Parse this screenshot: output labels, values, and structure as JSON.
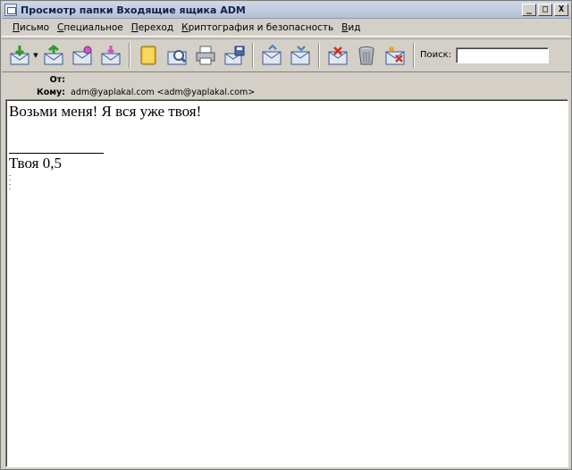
{
  "window": {
    "title": "Просмотр папки Входящие ящика ADM",
    "controls": {
      "minimize": "_",
      "maximize": "□",
      "close": "X"
    }
  },
  "menu": [
    {
      "underline": "П",
      "rest": "исьмо"
    },
    {
      "underline": "С",
      "rest": "пециальное"
    },
    {
      "underline": "П",
      "rest": "ереход"
    },
    {
      "underline": "К",
      "rest": "риптография и безопасность"
    },
    {
      "underline": "В",
      "rest": "ид"
    }
  ],
  "toolbar": {
    "icons": [
      "get-mail-icon",
      "reply-all-icon",
      "forward-icon",
      "send-icon",
      "address-book-icon",
      "find-icon",
      "print-icon",
      "save-icon",
      "previous-icon",
      "next-icon",
      "delete-message-icon",
      "trash-icon",
      "mark-spam-icon"
    ],
    "search_label": "Поиск:",
    "search_value": ""
  },
  "headers": {
    "from_label": "От:",
    "from_value": "",
    "to_label": "Кому:",
    "to_value": "adm@yaplakal.com <adm@yaplakal.com>"
  },
  "message": {
    "body_text": "Возьми меня! Я вся уже твоя!",
    "signature": "Твоя 0,5"
  },
  "colors": {
    "window_bg": "#d4d0c8",
    "titlebar_text": "#10204a",
    "body_bg": "#ffffff"
  }
}
